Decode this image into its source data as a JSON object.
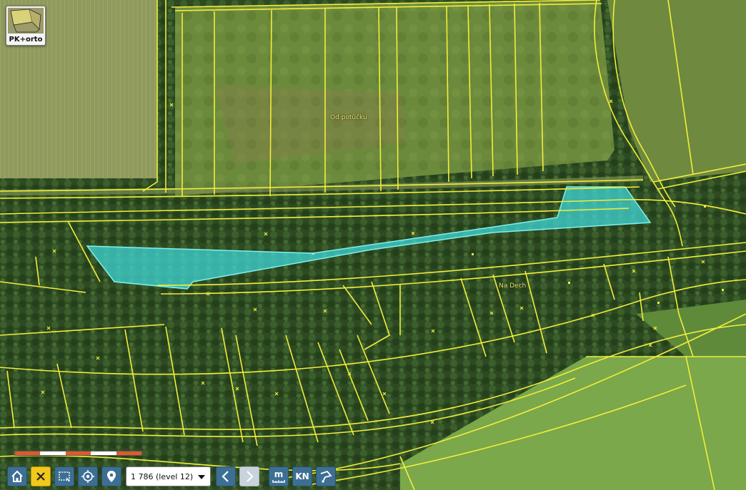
{
  "map": {
    "labels": {
      "od_potucku": "Od potůčku",
      "na_dech": "Na Dech"
    },
    "colors": {
      "parcel_line": "#f2ee3a",
      "selected_fill": "#3fd6d6",
      "selected_stroke": "#7ef2ef"
    }
  },
  "layer_switch": {
    "label": "PK+orto"
  },
  "scalebar": {
    "colors": [
      "#e05a2a",
      "#ffffff"
    ]
  },
  "toolbar": {
    "home_icon": "home-icon",
    "close_icon": "close-icon",
    "select_area_icon": "select-area-icon",
    "locate_icon": "locate-icon",
    "marker_icon": "map-marker-icon",
    "scale_select": {
      "value": "1 786 (level 12)"
    },
    "back_icon": "chevron-left-icon",
    "forward_icon": "chevron-right-icon",
    "measure_label": "m",
    "kn_label": "KN",
    "draw_icon": "draw-polygon-icon"
  }
}
